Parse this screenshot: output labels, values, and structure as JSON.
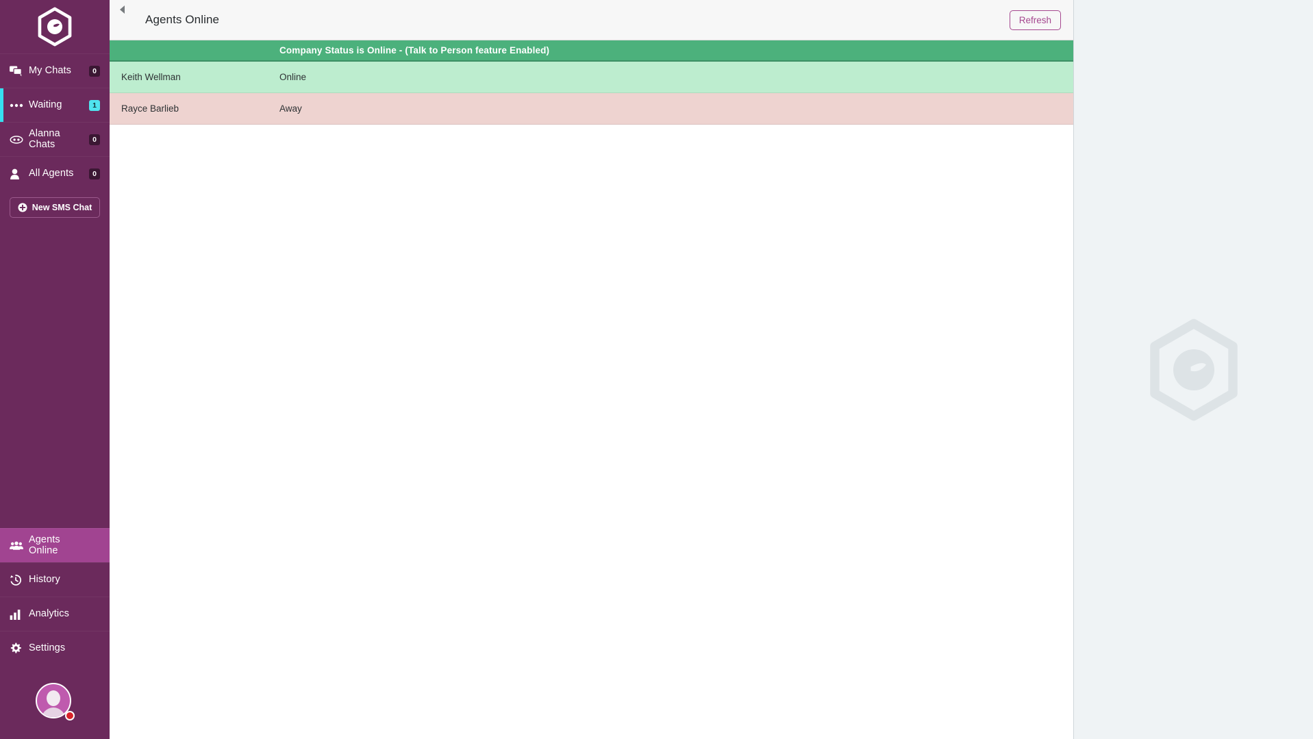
{
  "brand": {
    "logo_icon": "hexagon-logo-icon",
    "accent_purple": "#6b2a5c",
    "accent_magenta": "#a14491",
    "accent_cyan": "#36dff0",
    "online_green": "#4cb17c",
    "away_red": "#eed3d0"
  },
  "sidebar": {
    "items": [
      {
        "label": "My Chats",
        "badge": "0",
        "icon": "chat-bubbles-icon",
        "state": "normal"
      },
      {
        "label": "Waiting",
        "badge": "1",
        "icon": "ellipsis-icon",
        "state": "waiting"
      },
      {
        "label": "Alanna\nChats",
        "badge": "0",
        "icon": "robot-face-icon",
        "state": "normal"
      },
      {
        "label": "All Agents",
        "badge": "0",
        "icon": "person-icon",
        "state": "normal"
      }
    ],
    "new_sms_button": {
      "label": "New SMS Chat",
      "icon": "plus-circle-icon"
    },
    "bottom_items": [
      {
        "label": "Agents\nOnline",
        "icon": "people-group-icon",
        "state": "active"
      },
      {
        "label": "History",
        "icon": "history-clock-icon",
        "state": "normal"
      },
      {
        "label": "Analytics",
        "icon": "bar-chart-icon",
        "state": "normal"
      },
      {
        "label": "Settings",
        "icon": "gear-icon",
        "state": "normal"
      }
    ],
    "avatar": {
      "icon": "user-avatar-icon",
      "status_dot_color": "#d8232a"
    }
  },
  "topbar": {
    "collapse_icon": "collapse-left-arrow-icon",
    "title": "Agents Online",
    "refresh_label": "Refresh"
  },
  "status_banner": {
    "text": "Company Status is Online - (Talk to Person feature Enabled)"
  },
  "agents_table": {
    "rows": [
      {
        "name": "Keith Wellman",
        "status": "Online",
        "state": "online"
      },
      {
        "name": "Rayce Barlieb",
        "status": "Away",
        "state": "away"
      }
    ]
  },
  "right_panel": {
    "watermark_icon": "hexagon-logo-watermark-icon"
  }
}
